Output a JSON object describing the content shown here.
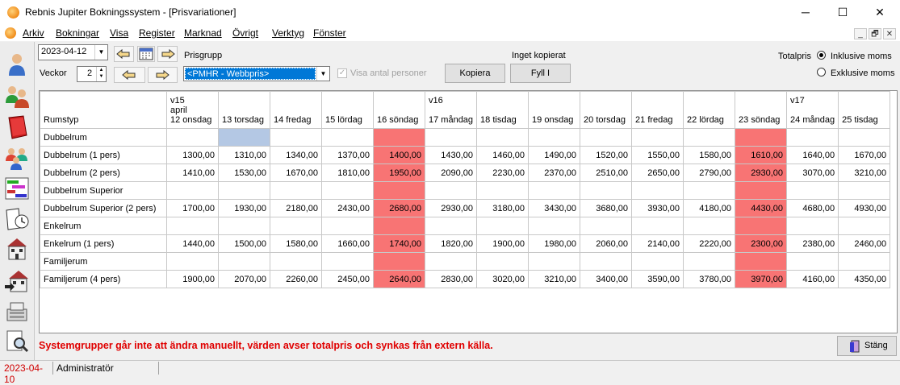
{
  "window": {
    "title": "Rebnis Jupiter Bokningssystem - [Prisvariationer]",
    "minimize": "─",
    "maximize": "☐",
    "close": "✕"
  },
  "menu": [
    {
      "label": "Arkiv"
    },
    {
      "label": "Bokningar"
    },
    {
      "label": "Visa"
    },
    {
      "label": "Register"
    },
    {
      "label": "Marknad"
    },
    {
      "label": "Övrigt"
    },
    {
      "label": "Verktyg"
    },
    {
      "label": "Fönster"
    }
  ],
  "mdi": {
    "minimize": "_",
    "restore": "🗗",
    "close": "✕"
  },
  "controls": {
    "date": "2023-04-12",
    "weeks_label": "Veckor",
    "weeks_value": "2",
    "prisgrupp_label": "Prisgrupp",
    "prisgrupp_value": "<PMHR - Webbpris>",
    "visa_antal": "Visa antal personer",
    "kopiera": "Kopiera",
    "inget_kopierat": "Inget kopierat",
    "fyll": "Fyll I",
    "totalpris_label": "Totalpris",
    "inklusive": "Inklusive moms",
    "exklusive": "Exklusive moms",
    "selected_moms": "inklusive"
  },
  "table": {
    "header_first": "Rumstyp",
    "columns": [
      {
        "week": "v15",
        "month": "april",
        "day": "12 onsdag",
        "sunday": false
      },
      {
        "week": "",
        "month": "",
        "day": "13 torsdag",
        "sunday": false
      },
      {
        "week": "",
        "month": "",
        "day": "14 fredag",
        "sunday": false
      },
      {
        "week": "",
        "month": "",
        "day": "15 lördag",
        "sunday": false
      },
      {
        "week": "",
        "month": "",
        "day": "16 söndag",
        "sunday": true
      },
      {
        "week": "v16",
        "month": "",
        "day": "17 måndag",
        "sunday": false
      },
      {
        "week": "",
        "month": "",
        "day": "18 tisdag",
        "sunday": false
      },
      {
        "week": "",
        "month": "",
        "day": "19 onsdag",
        "sunday": false
      },
      {
        "week": "",
        "month": "",
        "day": "20 torsdag",
        "sunday": false
      },
      {
        "week": "",
        "month": "",
        "day": "21 fredag",
        "sunday": false
      },
      {
        "week": "",
        "month": "",
        "day": "22 lördag",
        "sunday": false
      },
      {
        "week": "",
        "month": "",
        "day": "23 söndag",
        "sunday": true
      },
      {
        "week": "v17",
        "month": "",
        "day": "24 måndag",
        "sunday": false
      },
      {
        "week": "",
        "month": "",
        "day": "25 tisdag",
        "sunday": false
      }
    ],
    "rows": [
      {
        "label": "Dubbelrum",
        "category": true,
        "values": []
      },
      {
        "label": "Dubbelrum (1 pers)",
        "category": false,
        "values": [
          "1300,00",
          "1310,00",
          "1340,00",
          "1370,00",
          "1400,00",
          "1430,00",
          "1460,00",
          "1490,00",
          "1520,00",
          "1550,00",
          "1580,00",
          "1610,00",
          "1640,00",
          "1670,00"
        ]
      },
      {
        "label": "Dubbelrum (2 pers)",
        "category": false,
        "values": [
          "1410,00",
          "1530,00",
          "1670,00",
          "1810,00",
          "1950,00",
          "2090,00",
          "2230,00",
          "2370,00",
          "2510,00",
          "2650,00",
          "2790,00",
          "2930,00",
          "3070,00",
          "3210,00"
        ]
      },
      {
        "label": "Dubbelrum Superior",
        "category": true,
        "values": []
      },
      {
        "label": "Dubbelrum Superior (2 pers)",
        "category": false,
        "values": [
          "1700,00",
          "1930,00",
          "2180,00",
          "2430,00",
          "2680,00",
          "2930,00",
          "3180,00",
          "3430,00",
          "3680,00",
          "3930,00",
          "4180,00",
          "4430,00",
          "4680,00",
          "4930,00"
        ]
      },
      {
        "label": "Enkelrum",
        "category": true,
        "values": []
      },
      {
        "label": "Enkelrum (1 pers)",
        "category": false,
        "values": [
          "1440,00",
          "1500,00",
          "1580,00",
          "1660,00",
          "1740,00",
          "1820,00",
          "1900,00",
          "1980,00",
          "2060,00",
          "2140,00",
          "2220,00",
          "2300,00",
          "2380,00",
          "2460,00"
        ]
      },
      {
        "label": "Familjerum",
        "category": true,
        "values": []
      },
      {
        "label": "Familjerum (4 pers)",
        "category": false,
        "values": [
          "1900,00",
          "2070,00",
          "2260,00",
          "2450,00",
          "2640,00",
          "2830,00",
          "3020,00",
          "3210,00",
          "3400,00",
          "3590,00",
          "3780,00",
          "3970,00",
          "4160,00",
          "4350,00"
        ]
      }
    ]
  },
  "footer": {
    "warning": "Systemgrupper går inte att ändra manuellt, värden avser totalpris och synkas från extern källa.",
    "close_button": "Stäng"
  },
  "statusbar": {
    "date": "2023-04-10",
    "user": "Administratör"
  },
  "colors": {
    "sunday": "#f87474",
    "selected_cell": "#b4c8e4",
    "warning_text": "#e00000",
    "status_date": "#d00000"
  }
}
